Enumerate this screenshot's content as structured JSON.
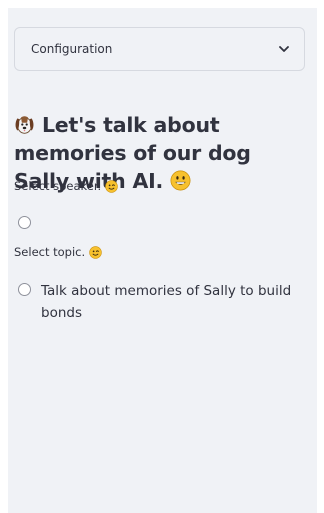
{
  "sidebar": {
    "expander": {
      "label": "Configuration",
      "icon": "chevron-down-icon"
    },
    "title": {
      "icon": "dog-face-icon",
      "text": "Let's talk about memories of our dog Sally with AI.",
      "trailing_icon": "grinning-face-icon"
    },
    "speaker": {
      "label": "Select speaker.",
      "icon": "winking-face-icon",
      "options": [
        ""
      ]
    },
    "topic": {
      "label": "Select topic.",
      "icon": "winking-face-icon",
      "options": [
        "Talk about memories of Sally to build bonds"
      ]
    }
  },
  "colors": {
    "sidebar_bg": "#f0f2f6",
    "text": "#31333f",
    "border": "#d6d9e0",
    "emoji_yellow": "#f7c12e"
  }
}
